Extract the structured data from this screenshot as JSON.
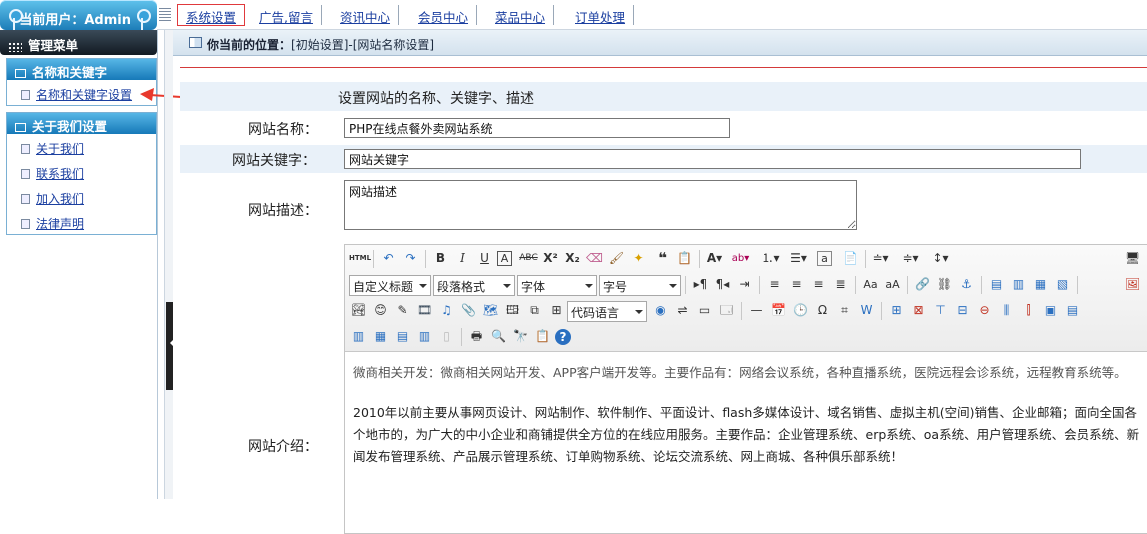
{
  "user": {
    "label": "当前用户：Admin"
  },
  "topnav": {
    "tabs": [
      "系统设置",
      "广告,留言",
      "资讯中心",
      "会员中心",
      "菜品中心",
      "订单处理"
    ]
  },
  "sidebar": {
    "menu_title": "管理菜单",
    "groups": [
      {
        "title": "名称和关键字",
        "items": [
          "名称和关键字设置"
        ]
      },
      {
        "title": "关于我们设置",
        "items": [
          "关于我们",
          "联系我们",
          "加入我们",
          "法律声明"
        ]
      }
    ]
  },
  "breadcrumb": {
    "label": "你当前的位置：",
    "path": "[初始设置]-[网站名称设置]"
  },
  "form": {
    "heading": "设置网站的名称、关键字、描述",
    "site_name_label": "网站名称：",
    "site_name_value": "PHP在线点餐外卖网站系统",
    "keywords_label": "网站关键字：",
    "keywords_value": "网站关键字",
    "description_label": "网站描述：",
    "description_value": "网站描述",
    "intro_label": "网站介绍："
  },
  "editor": {
    "selects": [
      "自定义标题",
      "段落格式",
      "字体",
      "字号",
      "代码语言"
    ],
    "content": [
      "微商相关开发：微商相关网站开发、APP客户端开发等。主要作品有：网络会议系统，各种直播系统，医院远程会诊系统，远程教育系统等。",
      "2010年以前主要从事网页设计、网站制作、软件制作、平面设计、flash多媒体设计、域名销售、虚拟主机(空间)销售、企业邮箱；面向全国各个地市的，为广大的中小企业和商铺提供全方位的在线应用服务。主要作品：企业管理系统、erp系统、oa系统、用户管理系统、会员系统、新闻发布管理系统、产品展示管理系统、订单购物系统、论坛交流系统、网上商城、各种俱乐部系统！"
    ]
  },
  "colors": {
    "accent": "#1d7db8",
    "active_tab_border": "#e0393c",
    "arrow": "#e8392d"
  }
}
